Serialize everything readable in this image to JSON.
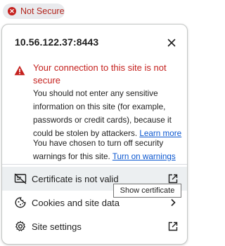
{
  "address_chip": {
    "label": "Not Secure",
    "icon": "error-circle-icon",
    "color": "#c5221f"
  },
  "popup": {
    "site": "10.56.122.37:8443",
    "close_icon": "close-icon",
    "warning": {
      "icon": "warning-triangle-icon",
      "heading": "Your connection to this site is not secure",
      "body": "You should not enter any sensitive information on this site (for example, passwords or credit cards), because it could be stolen by attackers.",
      "learn_more": "Learn more",
      "turned_off_text": "You have chosen to turn off security warnings for this site.",
      "turn_on": "Turn on warnings"
    },
    "items": [
      {
        "label": "Certificate is not valid",
        "icon": "certificate-invalid-icon",
        "end_icon": "open-external-icon"
      },
      {
        "label": "Cookies and site data",
        "icon": "cookie-icon",
        "end_icon": "chevron-right-icon"
      },
      {
        "label": "Site settings",
        "icon": "gear-icon",
        "end_icon": "open-external-icon"
      }
    ],
    "tooltip": "Show certificate"
  },
  "colors": {
    "error": "#c5221f",
    "link": "#0b57d0",
    "hover_row": "#eceff1"
  }
}
